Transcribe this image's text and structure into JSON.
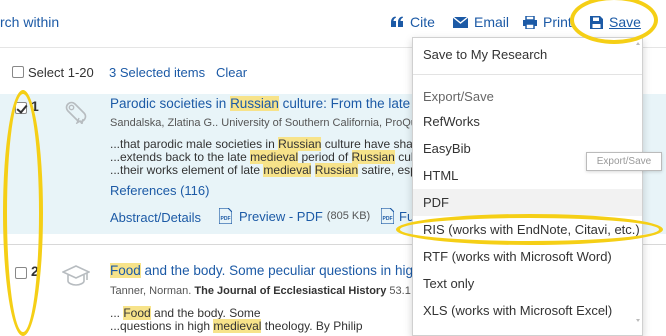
{
  "toolbar": {
    "search_within": "rch within",
    "cite": "Cite",
    "email": "Email",
    "print": "Print",
    "save": "Save"
  },
  "select_bar": {
    "select_label": "Select 1-20",
    "selected_items": "3 Selected items",
    "clear": "Clear"
  },
  "records": [
    {
      "number": "1",
      "checked": true,
      "title_pre": "Parodic societies in ",
      "title_hl": "Russian",
      "title_post": " culture: From the late ",
      "title_tail": "m",
      "author": "Sandalska, Zlatina G.. University of Southern California, ProQue",
      "snippets": [
        [
          "...that parodic male societies in ",
          "Russian",
          " culture have shar"
        ],
        [
          "...extends back to the late ",
          "medieval",
          " period of ",
          "Russian",
          " cultu"
        ],
        [
          "...their works element of late ",
          "medieval",
          " ",
          "Russian",
          " satire, esp"
        ]
      ],
      "references": "References (116)",
      "abstract_details": "Abstract/Details",
      "preview_pdf": "Preview - PDF",
      "pdf_size": "(805 KB)",
      "fu_link": "Fu"
    },
    {
      "number": "2",
      "checked": false,
      "title_hl": "Food",
      "title_post": " and the body. Some peculiar questions in high ",
      "title_tail": "m",
      "author_pre": "Tanner, Norman. ",
      "author_journal": "The Journal of Ecclesiastical History",
      "author_post": " 53.1  (Ja",
      "snippets": [
        [
          "... ",
          "Food",
          " and the body. Some"
        ],
        [
          "...questions in high ",
          "medieval",
          " theology. By Philip"
        ]
      ]
    }
  ],
  "save_menu": {
    "save_to_research": "Save to My Research",
    "export_header": "Export/Save",
    "items": [
      "RefWorks",
      "EasyBib",
      "HTML",
      "PDF",
      "RIS (works with EndNote, Citavi, etc.)",
      "RTF (works with Microsoft Word)",
      "Text only",
      "XLS (works with Microsoft Excel)"
    ]
  },
  "tooltip": "Export/Save",
  "colors": {
    "link": "#1c5aa6",
    "highlight": "#f7e38a",
    "record_selected_bg": "#e8f4f8",
    "annotation": "#f5cf16"
  }
}
